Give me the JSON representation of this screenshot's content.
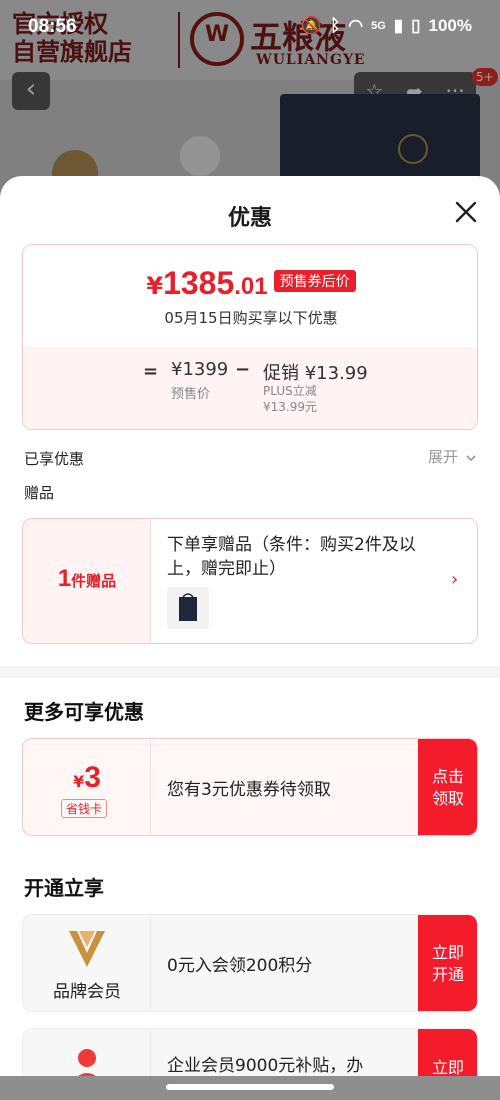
{
  "status_bar": {
    "time": "08:56",
    "battery": "100%",
    "signal": "5G"
  },
  "background": {
    "authorized_line1": "官方授权",
    "authorized_line2": "自营旗舰店",
    "brand_cn": "五粮液",
    "brand_en": "WULIANGYE",
    "logo_letter": "W",
    "cart_badge": "5+"
  },
  "sheet": {
    "title": "优惠",
    "price": {
      "symbol": "¥",
      "integer": "1385",
      "decimal": ".01",
      "tag": "预售券后价",
      "subtitle": "05月15日购买享以下优惠"
    },
    "calc": {
      "equals": "=",
      "presale_price": "¥1399",
      "presale_label": "预售价",
      "minus": "−",
      "promo_value": "促销 ¥13.99",
      "promo_label_1": "PLUS立减",
      "promo_label_2": "¥13.99元"
    },
    "enjoyed_label": "已享优惠",
    "expand_label": "展开",
    "gift_section_label": "赠品",
    "gift": {
      "count": "1",
      "count_suffix": "件赠品",
      "description": "下单享赠品（条件：购买2件及以上，赠完即止）",
      "arrow": "›"
    },
    "more_title": "更多可享优惠",
    "coupon": {
      "symbol": "¥",
      "amount": "3",
      "label": "省钱卡",
      "text": "您有3元优惠券待领取",
      "button_line1": "点击",
      "button_line2": "领取"
    },
    "open_title": "开通立享",
    "brand_member": {
      "label": "品牌会员",
      "text": "0元入会领200积分",
      "button_line1": "立即",
      "button_line2": "开通"
    },
    "enterprise_member": {
      "text": "企业会员9000元补贴，办",
      "button_line1": "立即"
    }
  },
  "colors": {
    "accent": "#e8202a",
    "button_red": "#f41b2b",
    "card_border": "#f6c9c9",
    "card_tint": "#fff3f3",
    "member_gold": "#c8913a"
  },
  "icons": [
    "back-icon",
    "star-icon",
    "share-icon",
    "more-icon",
    "close-icon",
    "chevron-down-icon",
    "chevron-right-icon",
    "brand-member-icon",
    "enterprise-member-icon"
  ]
}
